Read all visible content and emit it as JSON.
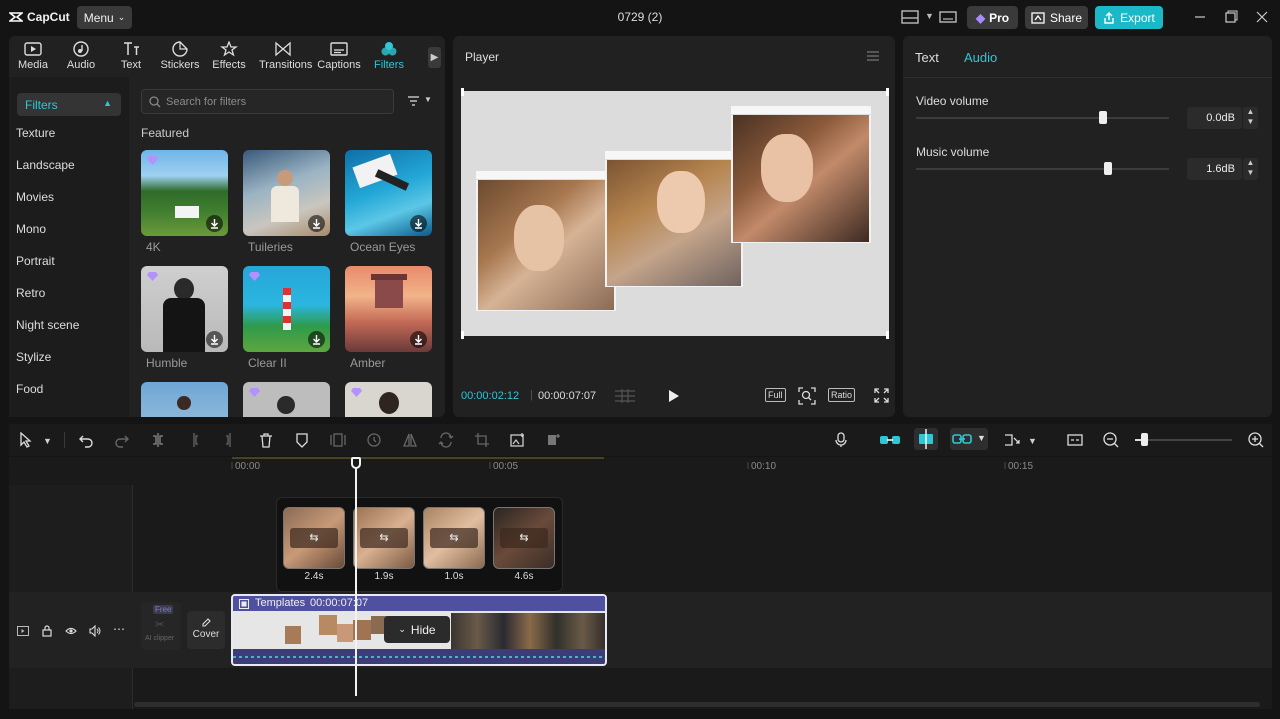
{
  "app": {
    "logo": "CapCut",
    "menu_label": "Menu",
    "doc_title": "0729 (2)",
    "pro_label": "Pro",
    "share_label": "Share",
    "export_label": "Export"
  },
  "tabs": [
    {
      "label": "Media",
      "icon": "media-icon"
    },
    {
      "label": "Audio",
      "icon": "audio-icon"
    },
    {
      "label": "Text",
      "icon": "text-icon"
    },
    {
      "label": "Stickers",
      "icon": "stickers-icon"
    },
    {
      "label": "Effects",
      "icon": "effects-icon"
    },
    {
      "label": "Transitions",
      "icon": "transitions-icon"
    },
    {
      "label": "Captions",
      "icon": "captions-icon"
    },
    {
      "label": "Filters",
      "icon": "filters-icon",
      "active": true
    }
  ],
  "sidebar": {
    "active": "Filters",
    "items": [
      "Texture",
      "Landscape",
      "Movies",
      "Mono",
      "Portrait",
      "Retro",
      "Night scene",
      "Stylize",
      "Food"
    ]
  },
  "filters": {
    "search_placeholder": "Search for filters",
    "section_title": "Featured",
    "items": [
      {
        "label": "4K",
        "premium": true
      },
      {
        "label": "Tuileries",
        "premium": false
      },
      {
        "label": "Ocean Eyes",
        "premium": false
      },
      {
        "label": "Humble",
        "premium": true
      },
      {
        "label": "Clear II",
        "premium": true
      },
      {
        "label": "Amber",
        "premium": false
      }
    ]
  },
  "player": {
    "title": "Player",
    "current_time": "00:00:02:12",
    "total_time": "00:00:07:07",
    "full_label": "Full",
    "ratio_label": "Ratio"
  },
  "properties": {
    "tabs": [
      "Text",
      "Audio"
    ],
    "active_tab": "Audio",
    "video_volume": {
      "label": "Video volume",
      "value": "0.0dB",
      "level": 0.74
    },
    "music_volume": {
      "label": "Music volume",
      "value": "1.6dB",
      "level": 0.76
    }
  },
  "timeline": {
    "ticks": [
      "00:00",
      "00:05",
      "00:10",
      "00:15"
    ],
    "clip_title": "Templates",
    "clip_duration": "00:00:07:07",
    "hide_label": "Hide",
    "cover_label": "Cover",
    "ai_label": "AI clipper",
    "free_label": "Free",
    "segments": [
      "2.4s",
      "1.9s",
      "1.0s",
      "4.6s"
    ]
  },
  "colors": {
    "accent": "#2ec7d6",
    "export": "#1bb8c8",
    "clip": "#5b5b97"
  }
}
